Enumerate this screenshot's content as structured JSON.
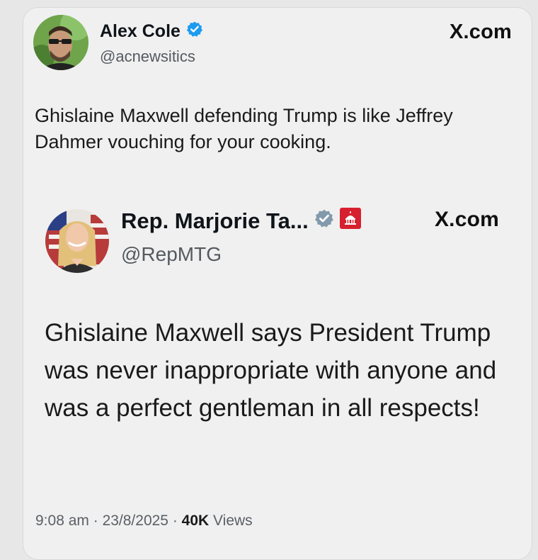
{
  "outer_tweet": {
    "author_name": "Alex Cole",
    "handle": "@acnewsitics",
    "source": "X.com",
    "text": "Ghislaine Maxwell defending Trump is like Jeffrey Dahmer vouching for your cooking.",
    "verified_color": "#1d9bf0"
  },
  "quoted_tweet": {
    "author_name": "Rep. Marjorie Ta...",
    "handle": "@RepMTG",
    "source": "X.com",
    "text": "Ghislaine Maxwell says President Trump was never inappropriate with anyone and was a perfect gentleman in all respects!",
    "verified_color": "#829aab",
    "affiliation_badge_color": "#d6202f"
  },
  "footer": {
    "time": "9:08 am",
    "separator": " · ",
    "date": "23/8/2025",
    "views_count": "40K",
    "views_label": " Views"
  }
}
